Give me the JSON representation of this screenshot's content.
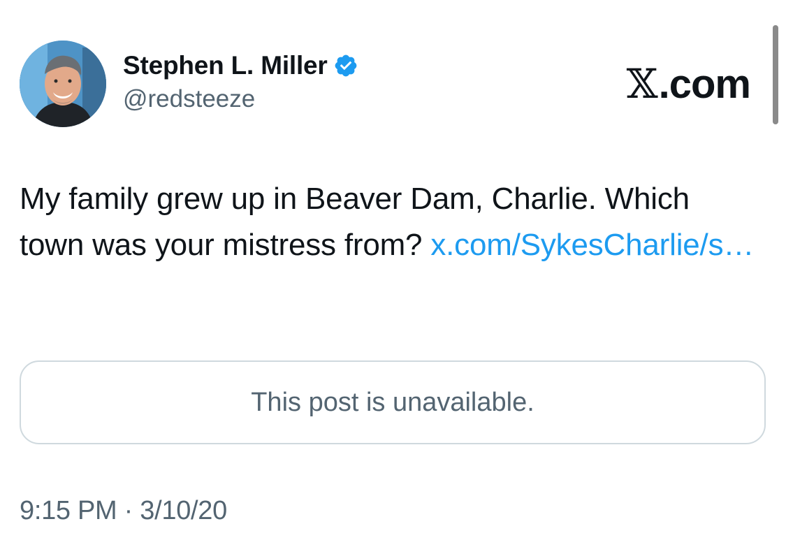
{
  "author": {
    "display_name": "Stephen L. Miller",
    "handle": "@redsteeze",
    "verified": true,
    "avatar": "avatar-photo"
  },
  "brand": {
    "x_glyph": "𝕏",
    "domain": ".com"
  },
  "tweet": {
    "text": "My family grew up in Beaver Dam, Charlie. Which town was your mistress from? ",
    "link_text": "x.com/​SykesCharlie/s…"
  },
  "quoted_post": {
    "message": "This post is unavailable."
  },
  "meta": {
    "timestamp": "9:15 PM · 3/10/20"
  },
  "colors": {
    "link": "#1d9bf0",
    "verified_badge": "#1d9bf0",
    "secondary_text": "#536471",
    "border": "#cfd9de"
  }
}
